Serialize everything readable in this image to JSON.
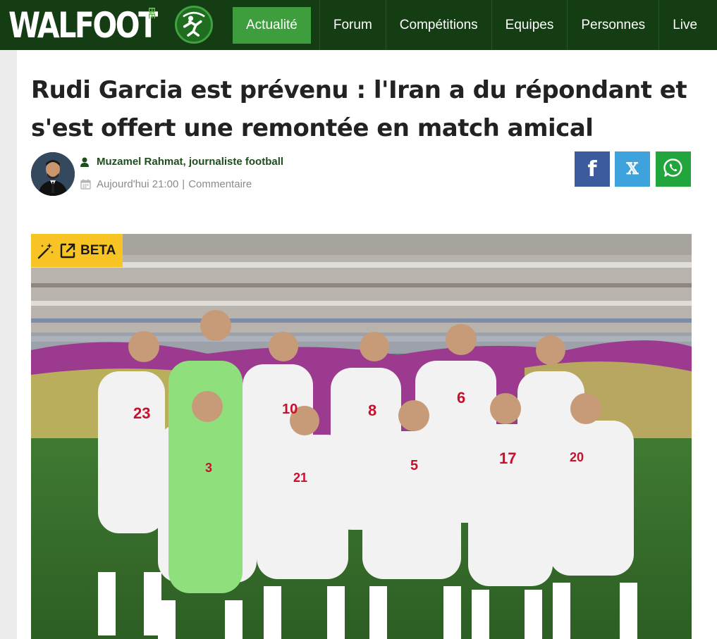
{
  "site": {
    "logo_text": "WALFOOT",
    "logo_suffix": "BE"
  },
  "nav": {
    "items": [
      {
        "label": "Actualité",
        "active": true
      },
      {
        "label": "Forum"
      },
      {
        "label": "Compétitions"
      },
      {
        "label": "Equipes"
      },
      {
        "label": "Personnes"
      },
      {
        "label": "Live"
      }
    ]
  },
  "article": {
    "title": "Rudi Garcia est prévenu : l'Iran a du répondant et s'est offert une remontée en match amical",
    "author": "Muzamel Rahmat, journaliste football",
    "date": "Aujourd'hui 21:00",
    "separator": "|",
    "comment_label": "Commentaire"
  },
  "share": {
    "facebook_label": "f",
    "x_label": "𝕏"
  },
  "photo": {
    "badge_label": "BETA",
    "jersey_numbers": [
      "23",
      "10",
      "8",
      "6",
      "3",
      "21",
      "5",
      "17",
      "20"
    ]
  },
  "icons": {
    "user": "user-icon",
    "calendar": "calendar-icon",
    "whatsapp": "whatsapp-icon",
    "magic": "magic-wand-icon",
    "external": "external-link-icon"
  },
  "colors": {
    "header_bg": "#143d14",
    "nav_active": "#3e9e3e",
    "author_text": "#1e4d1e",
    "facebook": "#3b5b9c",
    "x": "#3ea3dc",
    "whatsapp": "#22a53c",
    "beta_badge": "#f8c425"
  }
}
